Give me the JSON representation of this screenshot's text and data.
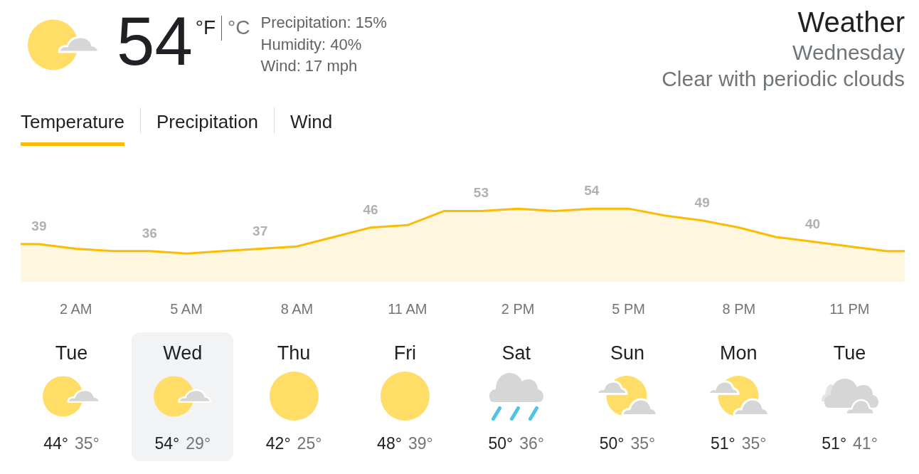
{
  "current": {
    "temperature": "54",
    "units": [
      {
        "label": "°F",
        "selected": true
      },
      {
        "label": "°C",
        "selected": false
      }
    ],
    "details": [
      "Precipitation: 15%",
      "Humidity: 40%",
      "Wind: 17 mph"
    ]
  },
  "summary": {
    "title": "Weather",
    "day": "Wednesday",
    "condition": "Clear with periodic clouds"
  },
  "tabs": [
    {
      "label": "Temperature",
      "selected": true
    },
    {
      "label": "Precipitation",
      "selected": false
    },
    {
      "label": "Wind",
      "selected": false
    }
  ],
  "hourly": {
    "chart_data": {
      "type": "area",
      "color": "#fbbc04",
      "categories": [
        null,
        "2 AM",
        null,
        null,
        "5 AM",
        null,
        null,
        "8 AM",
        null,
        null,
        "11 AM",
        null,
        null,
        "2 PM",
        null,
        null,
        "5 PM",
        null,
        null,
        "8 PM",
        null,
        null,
        "11 PM",
        null
      ],
      "values": [
        39,
        37,
        36,
        36,
        35,
        36,
        37,
        38,
        42,
        46,
        47,
        53,
        53,
        54,
        53,
        54,
        54,
        51,
        49,
        46,
        42,
        40,
        38,
        36
      ],
      "value_labels": [
        "39",
        null,
        null,
        "36",
        null,
        null,
        "37",
        null,
        null,
        "46",
        null,
        null,
        "53",
        null,
        null,
        "54",
        null,
        null,
        "49",
        null,
        null,
        "40",
        null,
        null
      ],
      "tick_labels": "x"
    }
  },
  "days": [
    {
      "day": "Tue",
      "kind": "suncloud",
      "high": "44°",
      "low": "35°",
      "selected": false
    },
    {
      "day": "Wed",
      "kind": "suncloud",
      "high": "54°",
      "low": "29°",
      "selected": true
    },
    {
      "day": "Thu",
      "kind": "sun",
      "high": "42°",
      "low": "25°",
      "selected": false
    },
    {
      "day": "Fri",
      "kind": "sun",
      "high": "48°",
      "low": "39°",
      "selected": false
    },
    {
      "day": "Sat",
      "kind": "rain",
      "high": "50°",
      "low": "36°",
      "selected": false
    },
    {
      "day": "Sun",
      "kind": "cloudsun",
      "high": "50°",
      "low": "35°",
      "selected": false
    },
    {
      "day": "Mon",
      "kind": "cloudsun",
      "high": "51°",
      "low": "35°",
      "selected": false
    },
    {
      "day": "Tue",
      "kind": "clouds",
      "high": "51°",
      "low": "41°",
      "selected": false
    }
  ]
}
